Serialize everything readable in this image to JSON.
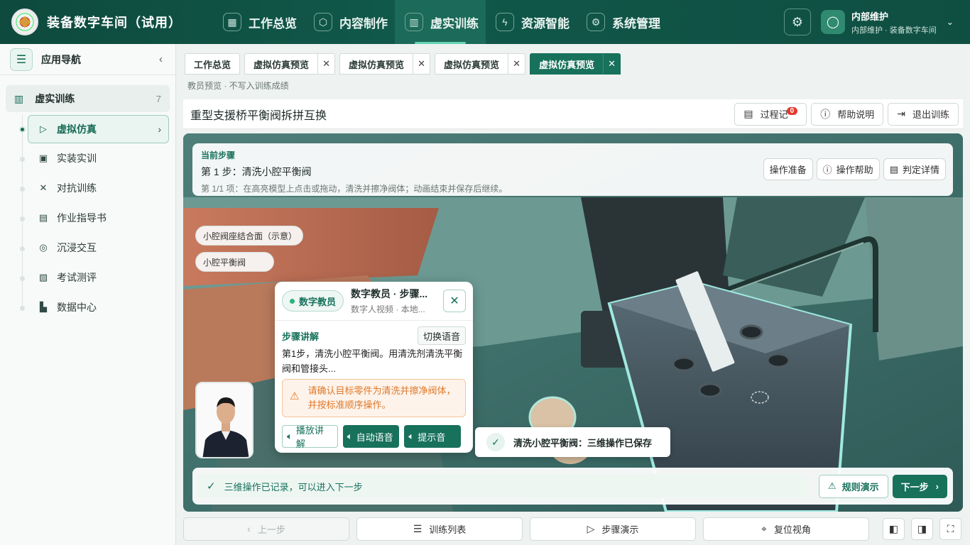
{
  "app": {
    "title": "装备数字车间（试用）"
  },
  "topnav": [
    {
      "label": "工作总览",
      "icon": "grid-icon",
      "glyph": "▦"
    },
    {
      "label": "内容制作",
      "icon": "cube-icon",
      "glyph": "⬡"
    },
    {
      "label": "虚实训练",
      "icon": "book-icon",
      "glyph": "▥",
      "active": true
    },
    {
      "label": "资源智能",
      "icon": "robot-icon",
      "glyph": "ϟ"
    },
    {
      "label": "系统管理",
      "icon": "gear-icon",
      "glyph": "⚙"
    }
  ],
  "user": {
    "name": "内部维护",
    "sub": "内部维护 · 装备数字车间"
  },
  "sidebar": {
    "title": "应用导航",
    "group": {
      "label": "虚实训练",
      "count": "7"
    },
    "items": [
      {
        "label": "虚拟仿真",
        "icon": "play-circle-icon",
        "glyph": "▷",
        "active": true
      },
      {
        "label": "实装实训",
        "icon": "monitor-icon",
        "glyph": "▣"
      },
      {
        "label": "对抗训练",
        "icon": "cross-swords-icon",
        "glyph": "✕"
      },
      {
        "label": "作业指导书",
        "icon": "document-icon",
        "glyph": "▤"
      },
      {
        "label": "沉浸交互",
        "icon": "vr-headset-icon",
        "glyph": "◎"
      },
      {
        "label": "考试测评",
        "icon": "clipboard-icon",
        "glyph": "▧"
      },
      {
        "label": "数据中心",
        "icon": "chart-icon",
        "glyph": "▙"
      }
    ]
  },
  "tabs": [
    {
      "label": "工作总览",
      "closable": false
    },
    {
      "label": "虚拟仿真预览",
      "closable": true
    },
    {
      "label": "虚拟仿真预览",
      "closable": true
    },
    {
      "label": "虚拟仿真预览",
      "closable": true
    },
    {
      "label": "虚拟仿真预览",
      "closable": true,
      "active": true
    }
  ],
  "breadcrumb": "教员预览 · 不写入训练成绩",
  "page": {
    "title": "重型支援桥平衡阀拆拼互换",
    "process_log_label": "过程记",
    "process_log_badge": "0",
    "help_label": "帮助说明",
    "exit_label": "退出训练"
  },
  "step": {
    "label": "当前步骤",
    "title": "第 1 步：清洗小腔平衡阀",
    "desc": "第 1/1 项：在高亮模型上点击或拖动，清洗并擦净阀体；动画结束并保存后继续。",
    "btn_prepare": "操作准备",
    "btn_help": "操作帮助",
    "btn_judge": "判定详情"
  },
  "scene": {
    "chip_seat": "小腔阀座结合面（示意）",
    "chip_valve": "小腔平衡阀"
  },
  "tutor": {
    "chip": "数字教员",
    "name": "数字教员 · 步骤...",
    "sub": "数字人视频 · 本地...",
    "section": "步骤讲解",
    "switch": "切换语音",
    "text": "第1步，清洗小腔平衡阀。用清洗剂清洗平衡阀和管接头...",
    "warning": "请确认目标零件为清洗并擦净阀体，并按标准顺序操作。",
    "btn_play": "播放讲解",
    "btn_auto": "自动语音",
    "btn_tone": "提示音"
  },
  "toast": "清洗小腔平衡阀：三维操作已保存",
  "footer": {
    "message": "三维操作已记录，可以进入下一步",
    "btn_rule": "规则演示",
    "btn_next": "下一步"
  },
  "bottom": {
    "prev": "上一步",
    "list": "训练列表",
    "demo": "步骤演示",
    "reset": "复位视角"
  }
}
